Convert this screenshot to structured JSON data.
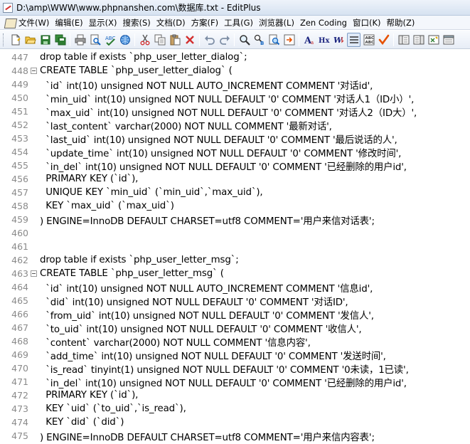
{
  "window": {
    "title": "D:\\amp\\WWW\\www.phpnanshen.com\\数据库.txt - EditPlus"
  },
  "menu": {
    "items": [
      "文件(W)",
      "编辑(E)",
      "显示(X)",
      "搜索(S)",
      "文档(D)",
      "方案(F)",
      "工具(G)",
      "浏览器(L)",
      "Zen Coding",
      "窗口(K)",
      "帮助(Z)"
    ]
  },
  "toolbar": {
    "buttons": [
      "new-file-icon",
      "open-folder-icon",
      "save-icon",
      "save-all-icon",
      "print-icon",
      "print-preview-icon",
      "spell-check-icon",
      "search-icon",
      "cut-icon",
      "copy-icon",
      "paste-icon",
      "delete-icon",
      "undo-icon",
      "redo-icon",
      "find-icon",
      "replace-icon",
      "find-in-files-icon",
      "goto-line-icon",
      "font-icon",
      "hex-icon",
      "word-wrap-icon",
      "line-number-icon",
      "column-selection-icon",
      "check-icon",
      "cliptext-icon",
      "directory-icon",
      "output-window-icon",
      "fullscreen-icon"
    ]
  },
  "editor": {
    "lines": [
      {
        "num": "447",
        "fold": false,
        "text": "drop table if exists `php_user_letter_dialog`;"
      },
      {
        "num": "448",
        "fold": true,
        "text": "CREATE TABLE `php_user_letter_dialog` ("
      },
      {
        "num": "449",
        "fold": false,
        "text": "  `id` int(10) unsigned NOT NULL AUTO_INCREMENT COMMENT '对话id',"
      },
      {
        "num": "450",
        "fold": false,
        "text": "  `min_uid` int(10) unsigned NOT NULL DEFAULT '0' COMMENT '对话人1（ID小）',"
      },
      {
        "num": "451",
        "fold": false,
        "text": "  `max_uid` int(10) unsigned NOT NULL DEFAULT '0' COMMENT '对话人2（ID大）',"
      },
      {
        "num": "452",
        "fold": false,
        "text": "  `last_content` varchar(2000) NOT NULL COMMENT '最新对话',"
      },
      {
        "num": "453",
        "fold": false,
        "text": "  `last_uid` int(10) unsigned NOT NULL DEFAULT '0' COMMENT '最后说话的人',"
      },
      {
        "num": "454",
        "fold": false,
        "text": "  `update_time` int(10) unsigned NOT NULL DEFAULT '0' COMMENT '修改时间',"
      },
      {
        "num": "455",
        "fold": false,
        "text": "  `in_del` int(10) unsigned NOT NULL DEFAULT '0' COMMENT '已经删除的用户id',"
      },
      {
        "num": "456",
        "fold": false,
        "text": "  PRIMARY KEY (`id`),"
      },
      {
        "num": "457",
        "fold": false,
        "text": "  UNIQUE KEY `min_uid` (`min_uid`,`max_uid`),"
      },
      {
        "num": "458",
        "fold": false,
        "text": "  KEY `max_uid` (`max_uid`)"
      },
      {
        "num": "459",
        "fold": false,
        "text": ") ENGINE=InnoDB DEFAULT CHARSET=utf8 COMMENT='用户来信对话表';"
      },
      {
        "num": "460",
        "fold": false,
        "text": ""
      },
      {
        "num": "461",
        "fold": false,
        "text": ""
      },
      {
        "num": "462",
        "fold": false,
        "text": "drop table if exists `php_user_letter_msg`;"
      },
      {
        "num": "463",
        "fold": true,
        "text": "CREATE TABLE `php_user_letter_msg` ("
      },
      {
        "num": "464",
        "fold": false,
        "text": "  `id` int(10) unsigned NOT NULL AUTO_INCREMENT COMMENT '信息id',"
      },
      {
        "num": "465",
        "fold": false,
        "text": "  `did` int(10) unsigned NOT NULL DEFAULT '0' COMMENT '对话ID',"
      },
      {
        "num": "466",
        "fold": false,
        "text": "  `from_uid` int(10) unsigned NOT NULL DEFAULT '0' COMMENT '发信人',"
      },
      {
        "num": "467",
        "fold": false,
        "text": "  `to_uid` int(10) unsigned NOT NULL DEFAULT '0' COMMENT '收信人',"
      },
      {
        "num": "468",
        "fold": false,
        "text": "  `content` varchar(2000) NOT NULL COMMENT '信息内容',"
      },
      {
        "num": "469",
        "fold": false,
        "text": "  `add_time` int(10) unsigned NOT NULL DEFAULT '0' COMMENT '发送时间',"
      },
      {
        "num": "470",
        "fold": false,
        "text": "  `is_read` tinyint(1) unsigned NOT NULL DEFAULT '0' COMMENT '0未读，1已读',"
      },
      {
        "num": "471",
        "fold": false,
        "text": "  `in_del` int(10) unsigned NOT NULL DEFAULT '0' COMMENT '已经删除的用户id',"
      },
      {
        "num": "472",
        "fold": false,
        "text": "  PRIMARY KEY (`id`),"
      },
      {
        "num": "473",
        "fold": false,
        "text": "  KEY `uid` (`to_uid`,`is_read`),"
      },
      {
        "num": "474",
        "fold": false,
        "text": "  KEY `did` (`did`)"
      },
      {
        "num": "475",
        "fold": false,
        "text": ") ENGINE=InnoDB DEFAULT CHARSET=utf8 COMMENT='用户来信内容表';"
      }
    ]
  }
}
